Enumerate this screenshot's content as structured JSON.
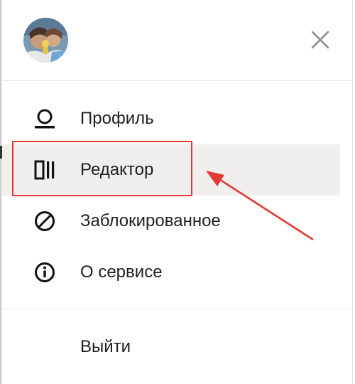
{
  "user": {
    "avatar": "avatar-photo"
  },
  "header": {
    "close_icon": "close-icon"
  },
  "menu": {
    "items": [
      {
        "label": "Профиль",
        "icon": "user-icon",
        "active": false
      },
      {
        "label": "Редактор",
        "icon": "editor-icon",
        "active": true
      },
      {
        "label": "Заблокированное",
        "icon": "blocked-icon",
        "active": false
      },
      {
        "label": "О сервисе",
        "icon": "info-icon",
        "active": false
      }
    ],
    "logout": {
      "label": "Выйти"
    }
  },
  "annotation": {
    "color": "#e53935",
    "target": "Редактор"
  },
  "colors": {
    "active_bg": "#f0efed",
    "text": "#1f1f1f",
    "divider": "#e6e6e6"
  }
}
